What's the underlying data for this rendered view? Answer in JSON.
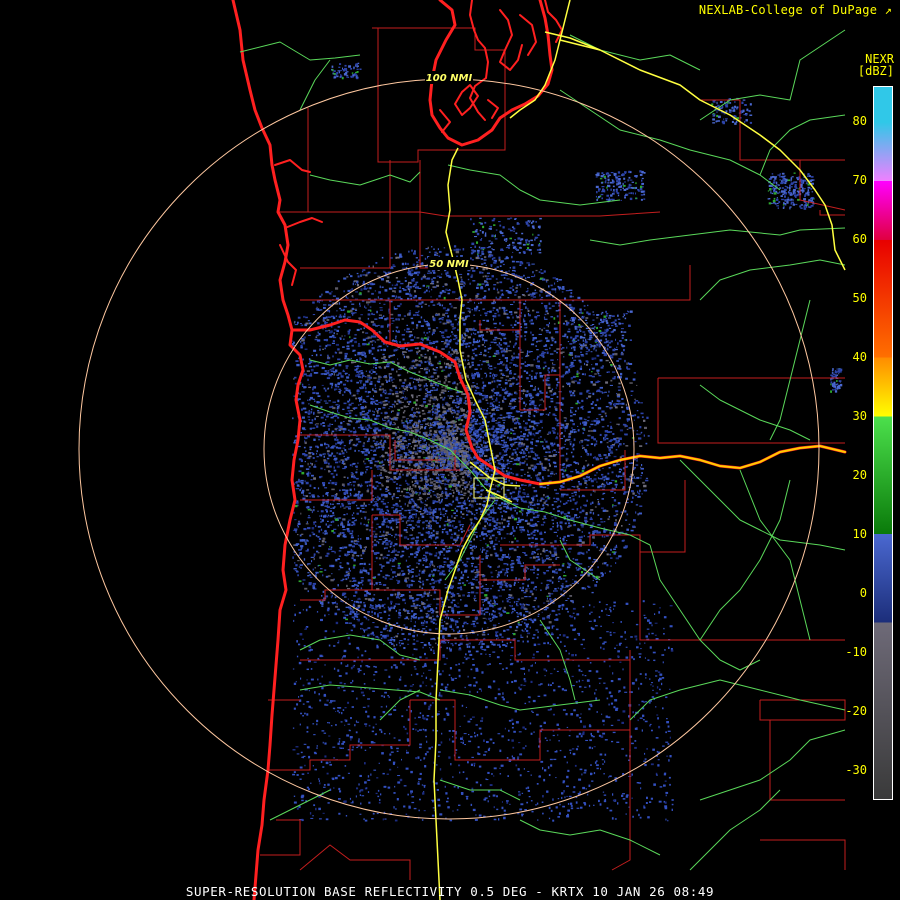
{
  "header": {
    "credit": "NEXLAB-College of DuPage",
    "credit_icon": "external-link-icon",
    "product_code": "NEXR",
    "units": "[dBZ]"
  },
  "rings": [
    {
      "label": "100 NMI"
    },
    {
      "label": "50 NMI"
    }
  ],
  "color_scale": {
    "ticks": [
      "80",
      "70",
      "60",
      "50",
      "40",
      "30",
      "20",
      "10",
      "0",
      "-10",
      "-20",
      "-30"
    ],
    "bands": [
      {
        "from": -35,
        "to": -5,
        "color": "#3a3a3a",
        "to_color": "#6e6a78"
      },
      {
        "from": -5,
        "to": 10,
        "color": "#1c2e7a",
        "to_color": "#4a68d0"
      },
      {
        "from": 10,
        "to": 30,
        "color": "#0a7a0a",
        "to_color": "#4ce04c"
      },
      {
        "from": 30,
        "to": 40,
        "color": "#ffff00",
        "to_color": "#ff8c00"
      },
      {
        "from": 40,
        "to": 60,
        "color": "#ff7000",
        "to_color": "#e80000"
      },
      {
        "from": 60,
        "to": 70,
        "color": "#e00040",
        "to_color": "#ff00ff"
      },
      {
        "from": 70,
        "to": 80,
        "color": "#f080ff",
        "to_color": "#30c8e8"
      },
      {
        "from": 80,
        "to": 86,
        "color": "#30c8e8",
        "to_color": "#30c8e8"
      }
    ]
  },
  "footer": {
    "caption": "SUPER-RESOLUTION BASE REFLECTIVITY 0.5 DEG - KRTX 10 JAN 26 08:49"
  },
  "colors": {
    "text": "#ffff00",
    "coast": "#ff2020",
    "county_borders": "#c02020",
    "highways": "#58d858",
    "interstates": "#ffff40",
    "range_rings": "#ffc8a0"
  }
}
